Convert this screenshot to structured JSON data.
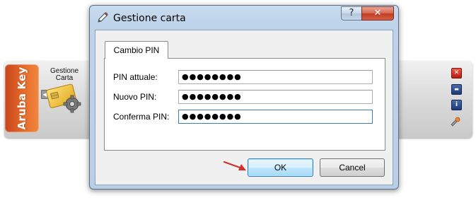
{
  "app": {
    "brand": "Aruba Key",
    "card_label_line1": "Gestione",
    "card_label_line2": "Carta",
    "side_buttons": {
      "close_glyph": "✕",
      "minimize_glyph": "▬",
      "info_glyph": "i"
    }
  },
  "dialog": {
    "title": "Gestione carta",
    "help_glyph": "?",
    "close_glyph": "✕",
    "tab_label": "Cambio PIN",
    "fields": [
      {
        "label": "PIN attuale:",
        "value": "●●●●●●●●"
      },
      {
        "label": "Nuovo PIN:",
        "value": "●●●●●●●●"
      },
      {
        "label": "Conferma PIN:",
        "value": "●●●●●●●●"
      }
    ],
    "ok_label": "OK",
    "cancel_label": "Cancel"
  },
  "colors": {
    "brand_orange": "#e66a2a",
    "dialog_frame": "#bdd3ea",
    "close_red": "#c23b22",
    "ok_border": "#3c7fb1",
    "arrow_red": "#d0302a"
  },
  "icons": {
    "title_icon": "edit-icon",
    "card_icon": "smartcard-gear-icon",
    "pointer": "arrow-pointer-icon"
  }
}
